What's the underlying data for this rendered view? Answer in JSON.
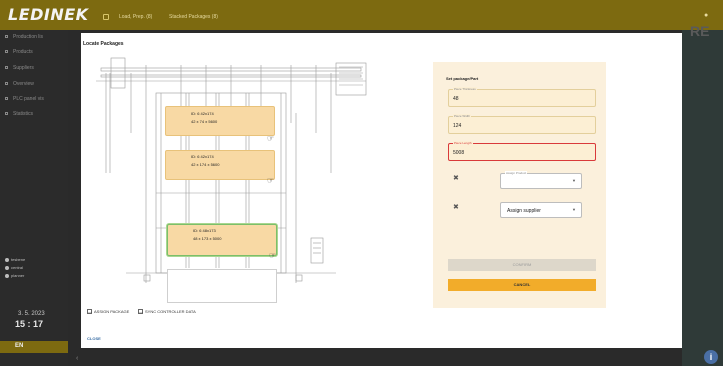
{
  "app": {
    "logo": "LEDINEK"
  },
  "topbar": {
    "tab1": "Load, Prep. (8)",
    "tab2": "Stacked Packages (8)",
    "user_icon": "person-icon"
  },
  "sidebar": {
    "items": [
      {
        "label": "Production lis"
      },
      {
        "label": "Products"
      },
      {
        "label": "Suppliers"
      },
      {
        "label": "Overview"
      },
      {
        "label": "PLC panel vis"
      },
      {
        "label": "Statistics"
      }
    ],
    "users": [
      {
        "label": "tesbene"
      },
      {
        "label": "central"
      },
      {
        "label": "planner"
      }
    ],
    "date": "3. 5. 2023",
    "time": "15 : 17",
    "lang": "EN"
  },
  "background": {
    "text": "RE"
  },
  "modal": {
    "title": "Locate Packages",
    "packages": [
      {
        "id": "ID: 6  42x174",
        "dims": "42 x 74 x 5600",
        "state": "normal"
      },
      {
        "id": "ID: 6  42x174",
        "dims": "42 x 174 x 5600",
        "state": "normal"
      },
      {
        "id": "ID: 6  48x173",
        "dims": "48 x 173 x 5000",
        "state": "selected"
      }
    ],
    "assign_package": "ASSIGN PACKAGE",
    "sync_data": "SYNC CONTROLLER DATA",
    "close": "CLOSE"
  },
  "form": {
    "title": "Set package/Part",
    "thickness": {
      "label": "Piece Thickness",
      "value": "48"
    },
    "width": {
      "label": "Piece Width",
      "value": "124"
    },
    "length": {
      "label": "Piece Length",
      "value": "5008"
    },
    "product": {
      "label": "Assign Product",
      "value": ""
    },
    "supplier": {
      "label": "",
      "value": "Assign supplier"
    },
    "confirm": "CONFIRM",
    "cancel": "CANCEL"
  },
  "colors": {
    "accent": "#f2ac2a",
    "brand": "#7d6a10",
    "package_fill": "#f8d9a4",
    "selected_fill": "#d7e9c2"
  }
}
